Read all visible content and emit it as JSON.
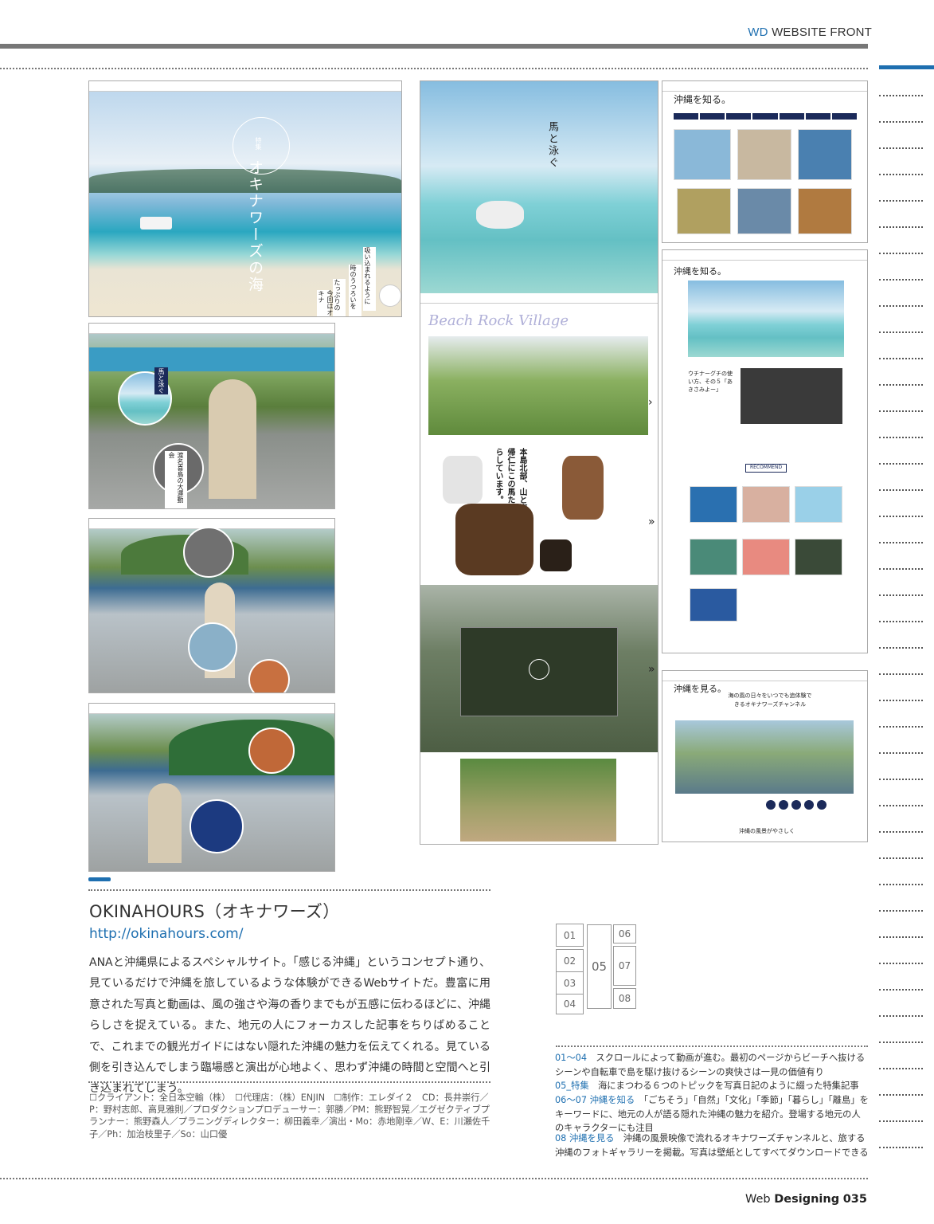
{
  "header": {
    "section_label_accent": "WD",
    "section_label": "WEBSITE FRONT"
  },
  "site": {
    "title": "OKINAHOURS（オキナワーズ）",
    "url": "http://okinahours.com/",
    "description": "ANAと沖縄県によるスペシャルサイト。「感じる沖縄」というコンセプト通り、見ているだけで沖縄を旅しているような体験ができるWebサイトだ。豊富に用意された写真と動画は、風の強さや海の香りまでもが五感に伝わるほどに、沖縄らしさを捉えている。また、地元の人にフォーカスした記事をちりばめることで、これまでの観光ガイドにはない隠れた沖縄の魅力を伝えてくれる。見ている側を引き込んでしまう臨場感と演出が心地よく、思わず沖縄の時間と空間へと引き込まれてしまう。",
    "credits": "☐クライアント：全日本空輸（株）　☐代理店：（株）ENJIN　☐制作：エレダイ２　CD：長井崇行／P：野村志郎、高見雅則／プロダクションプロデューサー：郭勝／PM：熊野智晃／エグゼクティブプランナー：熊野森人／プラニングディレクター：柳田義幸／演出・Mo：赤地剛幸／W、E：川瀬佐千子／Ph：加治枝里子／So：山口優"
  },
  "screens": {
    "s1_title_vertical": "オキナワーズの海",
    "s1_label": "特集",
    "s1_copy_a": "吸い込まれるように",
    "s1_copy_b": "時のうつろいを",
    "s1_copy_c": "たっぷりの",
    "s1_copy_d": "今回はオキナ",
    "s2_circle1": "馬と泳ぐ",
    "s2_circle2": "渡名喜島の大運動会",
    "s5_title_vertical": "馬と泳ぐ",
    "s5_banner": "Beach Rock Village",
    "s5_body_vertical": "本島北部、山と海の今帰仁にこの馬たちは暮らしています。",
    "s6_heading": "沖縄を知る。",
    "s7_heading": "沖縄を知る。",
    "s7_subhead": "ウチナーグチの使い方、その５「あきさみよー」",
    "s7_button": "RECOMMEND",
    "s8_heading": "沖縄を見る。",
    "s8_copy": "海の風の日々をいつでも追体験できるオキナワーズチャンネル",
    "s8_footer": "沖縄の風景がやさしく"
  },
  "figure_index": {
    "left": [
      "01",
      "02",
      "03",
      "04"
    ],
    "center": "05",
    "right": [
      "06",
      "07",
      "08"
    ]
  },
  "captions": [
    {
      "key": "01～04",
      "text": "スクロールによって動画が進む。最初のページからビーチへ抜けるシーンや自転車で島を駆け抜けるシーンの爽快さは一見の価値有り"
    },
    {
      "key": "05_特集",
      "text": "海にまつわる６つのトピックを写真日記のように綴った特集記事"
    },
    {
      "key": "06～07 沖縄を知る",
      "text": "「ごちそう」「自然」「文化」「季節」「暮らし」「離島」をキーワードに、地元の人が語る隠れた沖縄の魅力を紹介。登場する地元の人のキャラクターにも注目"
    },
    {
      "key": "08 沖縄を見る",
      "text": "沖縄の風景映像で流れるオキナワーズチャンネルと、旅する沖縄のフォトギャラリーを掲載。写真は壁紙としてすべてダウンロードできる"
    }
  ],
  "footer": {
    "magazine_light": "Web ",
    "magazine_bold": "Designing",
    "page_number": "035"
  }
}
